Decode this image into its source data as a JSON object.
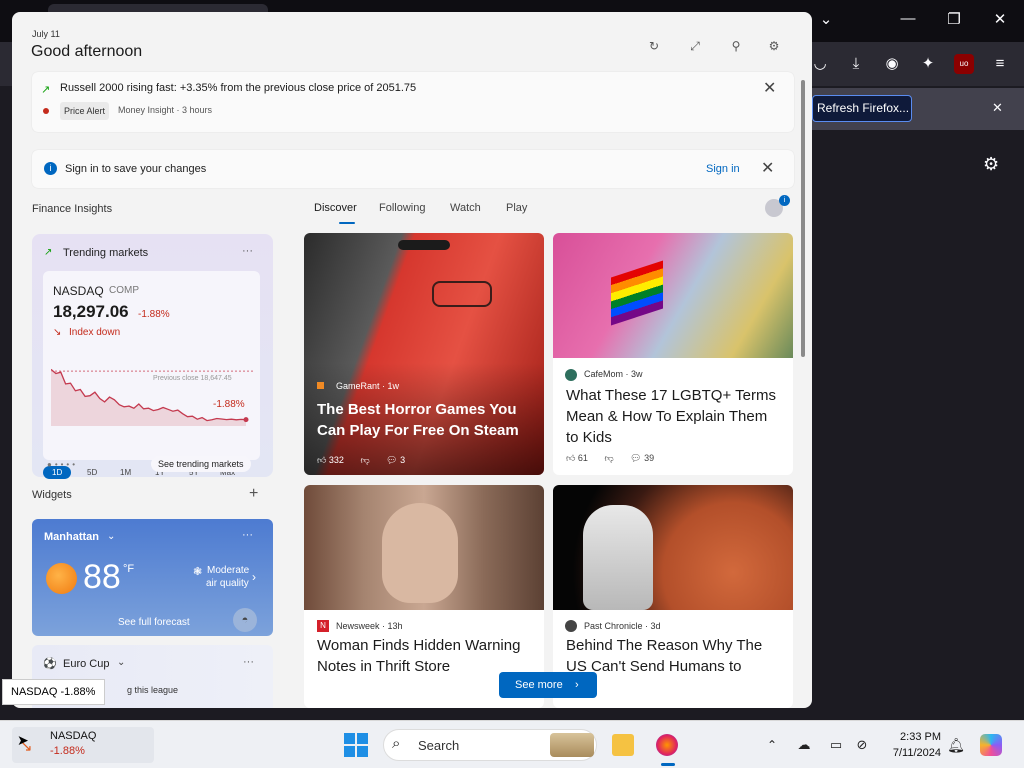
{
  "browser": {
    "notification_button": "Refresh Firefox...",
    "colors": {
      "tabbar": "#0e0d12",
      "toolbar": "#2b2a33",
      "content": "#1c1b22"
    }
  },
  "panel": {
    "date": "July 11",
    "greeting": "Good afternoon",
    "header_icons": [
      "refresh-icon",
      "expand-icon",
      "pin-icon",
      "settings-icon"
    ],
    "alert": {
      "title": "Russell 2000 rising fast: +3.35% from the previous close price of 2051.75",
      "badge": "Price Alert",
      "source": "Money Insight · 3 hours"
    },
    "signin": {
      "text": "Sign in to save your changes",
      "link": "Sign in"
    },
    "finance_insights": "Finance Insights",
    "tabs": [
      "Discover",
      "Following",
      "Watch",
      "Play"
    ],
    "active_tab": "Discover",
    "trending": {
      "title": "Trending markets",
      "more": "···",
      "symbol": "NASDAQ",
      "exchange": "COMP",
      "price": "18,297.06",
      "change": "-1.88%",
      "status": "Index down",
      "prev_close": "Previous close 18,647.45",
      "chart_change": "-1.88%",
      "periods": [
        "1D",
        "5D",
        "1M",
        "1Y",
        "5Y",
        "Max"
      ],
      "active_period": "1D",
      "see_link": "See trending markets",
      "chart_data": {
        "type": "line",
        "x": [
          0,
          1,
          2,
          3,
          4,
          5,
          6,
          7,
          8,
          9,
          10,
          11,
          12,
          13,
          14,
          15,
          16,
          17,
          18,
          19,
          20,
          21,
          22,
          23,
          24,
          25,
          26,
          27,
          28,
          29,
          30,
          31,
          32,
          33,
          34,
          35,
          36,
          37,
          38,
          39,
          40
        ],
        "values": [
          18660,
          18630,
          18640,
          18555,
          18560,
          18505,
          18515,
          18465,
          18470,
          18495,
          18450,
          18425,
          18460,
          18440,
          18405,
          18390,
          18395,
          18380,
          18410,
          18375,
          18380,
          18362,
          18370,
          18385,
          18372,
          18358,
          18366,
          18340,
          18318,
          18322,
          18300,
          18312,
          18290,
          18296,
          18305,
          18302,
          18297,
          18300,
          18296,
          18299,
          18297
        ],
        "baseline": 18647.45,
        "colors": {
          "line": "#c43a4f",
          "fill": "#e9c7cf",
          "baseline": "#d46a7a"
        }
      }
    },
    "widgets_title": "Widgets",
    "add_icon": "+",
    "weather": {
      "location": "Manhattan",
      "temp": "88",
      "unit": "°F",
      "air": "Moderate",
      "air2": "air quality",
      "forecast_link": "See full forecast"
    },
    "euro": {
      "title": "Euro Cup",
      "sub": "g this league",
      "more": "···"
    },
    "news": [
      {
        "source": "GameRant · 1w",
        "title": "The Best Horror Games You Can Play For Free On Steam",
        "likes": "332",
        "comments": "3"
      },
      {
        "source": "CafeMom · 3w",
        "title": "What These 17 LGBTQ+ Terms Mean & How To Explain Them to Kids",
        "likes": "61",
        "comments": "39"
      },
      {
        "source": "Newsweek · 13h",
        "title": "Woman Finds Hidden Warning Notes in Thrift Store",
        "likes": "",
        "comments": ""
      },
      {
        "source": "Past Chronicle · 3d",
        "title": "Behind The Reason Why The US Can't Send Humans to",
        "likes": "",
        "comments": ""
      }
    ],
    "see_more": "See more"
  },
  "tooltip": "NASDAQ -1.88%",
  "taskbar": {
    "widget_title": "NASDAQ",
    "widget_change": "-1.88%",
    "search_placeholder": "Search",
    "time": "2:33 PM",
    "date": "7/11/2024"
  }
}
